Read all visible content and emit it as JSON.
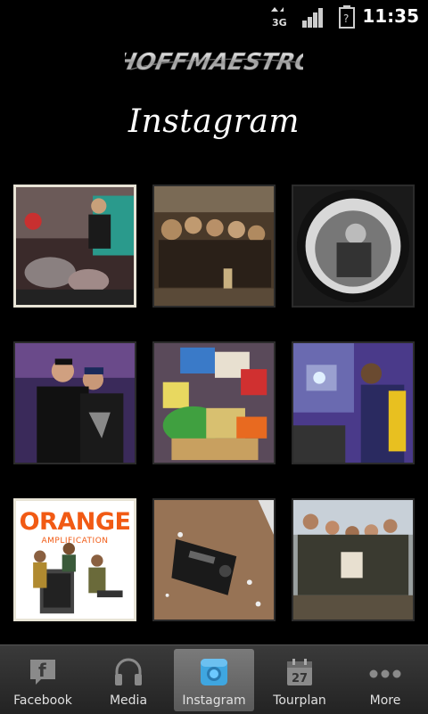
{
  "status_bar": {
    "network": "3G",
    "battery": "?",
    "time": "11:35",
    "icons": [
      "3g-icon",
      "signal-icon",
      "battery-icon"
    ]
  },
  "header": {
    "logo_text": "HOFFMAESTRO",
    "title": "Instagram"
  },
  "photos": [
    {
      "name": "photo-drummer",
      "subject": "drummer"
    },
    {
      "name": "photo-band-kitchen",
      "subject": "band-kitchen"
    },
    {
      "name": "photo-fisheye-bw",
      "subject": "fisheye"
    },
    {
      "name": "photo-two-men",
      "subject": "two-men"
    },
    {
      "name": "photo-snacks-table",
      "subject": "snacks"
    },
    {
      "name": "photo-singer-purple",
      "subject": "singer"
    },
    {
      "name": "photo-orange-amplification",
      "subject": "orange",
      "brand": "ORANGE",
      "brand_sub": "AMPLIFICATION"
    },
    {
      "name": "photo-mousetrap",
      "subject": "mousetrap"
    },
    {
      "name": "photo-group-outdoor",
      "subject": "group"
    }
  ],
  "tab_bar": {
    "tabs": [
      {
        "label": "Facebook",
        "icon": "facebook-icon",
        "active": false
      },
      {
        "label": "Media",
        "icon": "headphones-icon",
        "active": false
      },
      {
        "label": "Instagram",
        "icon": "camera-icon",
        "active": true
      },
      {
        "label": "Tourplan",
        "icon": "calendar-icon",
        "active": false,
        "icon_text": "27"
      },
      {
        "label": "More",
        "icon": "more-icon",
        "active": false
      }
    ]
  },
  "colors": {
    "background": "#000000",
    "tab_bar": "#2e2e2e",
    "tab_active": "#6a6a6a",
    "orange_brand": "#f15a14"
  }
}
